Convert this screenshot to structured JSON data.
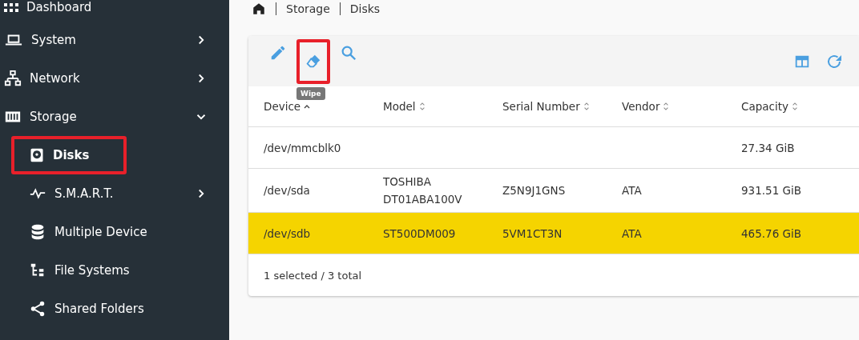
{
  "sidebar": {
    "items": [
      {
        "label": "Dashboard",
        "selected": false,
        "highlighted": false
      },
      {
        "label": "System",
        "expanded": false,
        "selected": false,
        "highlighted": false
      },
      {
        "label": "Network",
        "expanded": false,
        "selected": false,
        "highlighted": false
      },
      {
        "label": "Storage",
        "expanded": true,
        "selected": false,
        "highlighted": false,
        "children": [
          {
            "label": "Disks",
            "selected": true,
            "highlighted": true
          },
          {
            "label": "S.M.A.R.T.",
            "expanded": false,
            "selected": false,
            "highlighted": false
          },
          {
            "label": "Multiple Device",
            "selected": false,
            "highlighted": false
          },
          {
            "label": "File Systems",
            "selected": false,
            "highlighted": false
          },
          {
            "label": "Shared Folders",
            "selected": false,
            "highlighted": false
          }
        ]
      }
    ]
  },
  "breadcrumb": [
    "Storage",
    "Disks"
  ],
  "toolbar": {
    "left": [
      {
        "kind": "edit",
        "highlighted": false
      },
      {
        "kind": "wipe",
        "highlighted": true,
        "tooltip": "Wipe"
      },
      {
        "kind": "search",
        "highlighted": false
      }
    ],
    "right": [
      {
        "kind": "columns",
        "highlighted": false
      },
      {
        "kind": "refresh",
        "highlighted": false
      }
    ]
  },
  "table": {
    "columns": [
      {
        "label": "Device",
        "sorted": true
      },
      {
        "label": "Model",
        "sorted": false
      },
      {
        "label": "Serial Number",
        "sorted": false
      },
      {
        "label": "Vendor",
        "sorted": false
      },
      {
        "label": "Capacity",
        "sorted": false
      }
    ],
    "rows": [
      {
        "selected": false,
        "cells": [
          [
            "/dev/mmcblk0"
          ],
          [],
          [],
          [],
          [
            "27.34 GiB"
          ]
        ]
      },
      {
        "selected": false,
        "cells": [
          [
            "/dev/sda"
          ],
          [
            "TOSHIBA",
            "DT01ABA100V"
          ],
          [
            "Z5N9J1GNS"
          ],
          [
            "ATA"
          ],
          [
            "931.51 GiB"
          ]
        ]
      },
      {
        "selected": true,
        "cells": [
          [
            "/dev/sdb"
          ],
          [
            "ST500DM009"
          ],
          [
            "5VM1CT3N"
          ],
          [
            "ATA"
          ],
          [
            "465.76 GiB"
          ]
        ]
      }
    ]
  },
  "footer": "1 selected / 3 total"
}
